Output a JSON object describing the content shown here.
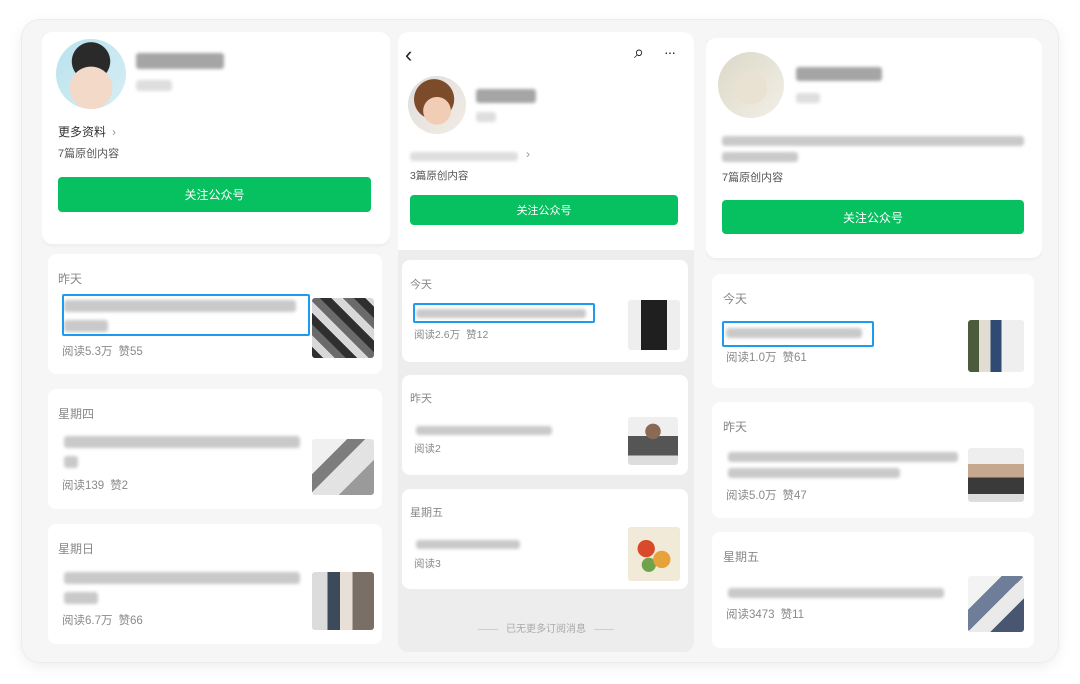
{
  "colors": {
    "accent": "#07c160",
    "highlight": "#1d9bf0"
  },
  "panel_left": {
    "more_info": "更多资料",
    "chevron": "›",
    "original_count": "7篇原创内容",
    "follow_label": "关注公众号",
    "articles": [
      {
        "day": "昨天",
        "read": "阅读5.3万",
        "like": "赞55"
      },
      {
        "day": "星期四",
        "read": "阅读139",
        "like": "赞2"
      },
      {
        "day": "星期日",
        "read": "阅读6.7万",
        "like": "赞66"
      }
    ]
  },
  "panel_middle": {
    "back_icon": "‹",
    "search_icon": "⌕",
    "more_icon": "···",
    "link_chevron": "›",
    "original_count": "3篇原创内容",
    "follow_label": "关注公众号",
    "articles": [
      {
        "day": "今天",
        "read": "阅读2.6万",
        "like": "赞12"
      },
      {
        "day": "昨天",
        "read": "阅读2",
        "like": ""
      },
      {
        "day": "星期五",
        "read": "阅读3",
        "like": ""
      }
    ],
    "end_note": "已无更多订阅消息"
  },
  "panel_right": {
    "original_count": "7篇原创内容",
    "follow_label": "关注公众号",
    "articles": [
      {
        "day": "今天",
        "read": "阅读1.0万",
        "like": "赞61"
      },
      {
        "day": "昨天",
        "read": "阅读5.0万",
        "like": "赞47"
      },
      {
        "day": "星期五",
        "read": "阅读3473",
        "like": "赞11"
      }
    ]
  }
}
